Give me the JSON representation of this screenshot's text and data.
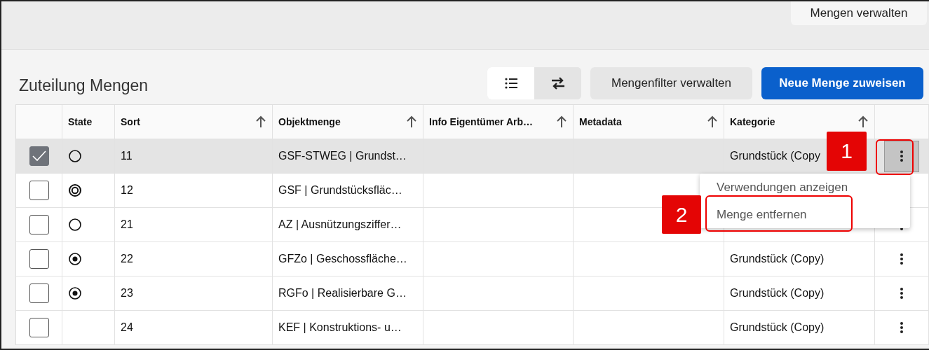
{
  "header": {
    "tab": "Mengen verwalten"
  },
  "section": {
    "title": "Zuteilung Mengen"
  },
  "view_toggle": [
    {
      "kind": "list",
      "selected": true
    },
    {
      "kind": "swap",
      "selected": false
    }
  ],
  "buttons": [
    {
      "label": "Mengenfilter verwalten",
      "kind": "secondary"
    },
    {
      "label": "Neue Menge zuweisen",
      "kind": "primary"
    }
  ],
  "table": {
    "columns": [
      {
        "label": "State",
        "sortable": false
      },
      {
        "label": "Sort",
        "sortable": true
      },
      {
        "label": "Objektmenge",
        "sortable": true
      },
      {
        "label": "Info Eigentümer Arb…",
        "sortable": true
      },
      {
        "label": "Metadata",
        "sortable": true
      },
      {
        "label": "Kategorie",
        "sortable": true
      }
    ],
    "rows": [
      {
        "selected": true,
        "checked": true,
        "state": {
          "kind": "empty"
        },
        "sort": "11",
        "objektmenge": "GSF-STWEG | Grundst…",
        "kategorie": "Grundstück (Copy",
        "menu_button": true,
        "menu_open": true
      },
      {
        "selected": false,
        "checked": false,
        "state": {
          "kind": "target"
        },
        "sort": "12",
        "objektmenge": "GSF | Grundstücksfläc…",
        "menu_button": false
      },
      {
        "selected": false,
        "checked": false,
        "state": {
          "kind": "empty"
        },
        "sort": "21",
        "objektmenge": "AZ | Ausnützungsziffer…",
        "menu_button": true,
        "menu_open": false
      },
      {
        "selected": false,
        "checked": false,
        "state": {
          "kind": "dot"
        },
        "sort": "22",
        "objektmenge": "GFZo | Geschossfläche…",
        "kategorie": "Grundstück (Copy)",
        "menu_button": true,
        "menu_open": false
      },
      {
        "selected": false,
        "checked": false,
        "state": {
          "kind": "dot"
        },
        "sort": "23",
        "objektmenge": "RGFo | Realisierbare G…",
        "kategorie": "Grundstück (Copy)",
        "menu_button": true,
        "menu_open": false
      },
      {
        "selected": false,
        "checked": false,
        "sort": "24",
        "objektmenge": "KEF | Konstruktions- u…",
        "kategorie": "Grundstück (Copy)",
        "menu_button": true,
        "menu_open": false
      }
    ]
  },
  "context_menu": {
    "items": [
      {
        "label": "Verwendungen anzeigen"
      },
      {
        "label": "Menge entfernen"
      }
    ]
  },
  "annotations": [
    {
      "number": "1"
    },
    {
      "number": "2"
    }
  ]
}
